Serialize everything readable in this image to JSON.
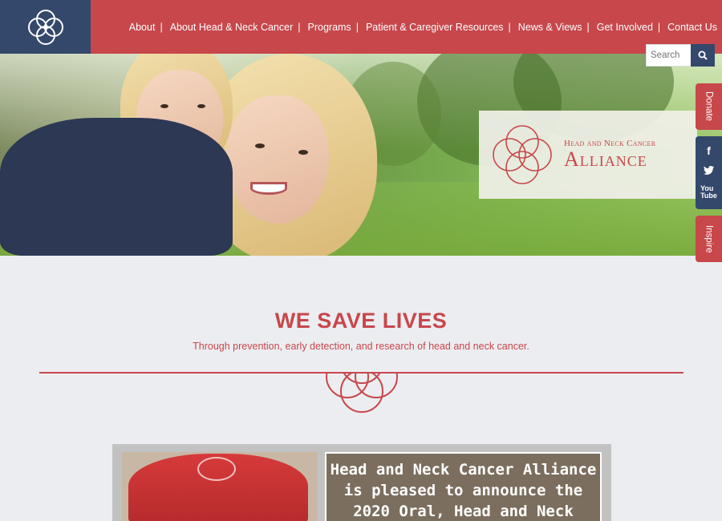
{
  "header": {
    "logo_name": "logo-emblem",
    "nav": [
      {
        "label": "About"
      },
      {
        "label": "About Head & Neck Cancer"
      },
      {
        "label": "Programs"
      },
      {
        "label": "Patient & Caregiver Resources"
      },
      {
        "label": "News & Views"
      },
      {
        "label": "Get Involved"
      },
      {
        "label": "Contact Us"
      }
    ],
    "separator": "|"
  },
  "search": {
    "placeholder": "Search",
    "icon": "search-icon"
  },
  "hero": {
    "brand_top": "Head and Neck Cancer",
    "brand_main": "Alliance"
  },
  "side_tabs": {
    "donate": "Donate",
    "inspire": "Inspire",
    "social": [
      {
        "icon": "facebook-icon",
        "glyph": "f"
      },
      {
        "icon": "twitter-icon",
        "glyph": "t"
      },
      {
        "icon": "youtube-icon",
        "glyph": "You"
      }
    ]
  },
  "main": {
    "headline": "WE SAVE LIVES",
    "subline": "Through prevention, early detection, and research of head and neck cancer."
  },
  "feature": {
    "lines": [
      "Head and Neck Cancer Alliance",
      "is pleased to announce the",
      "2020 Oral, Head and Neck"
    ]
  },
  "colors": {
    "brand_red": "#c7474b",
    "brand_navy": "#34486b",
    "background": "#ecedf1"
  }
}
